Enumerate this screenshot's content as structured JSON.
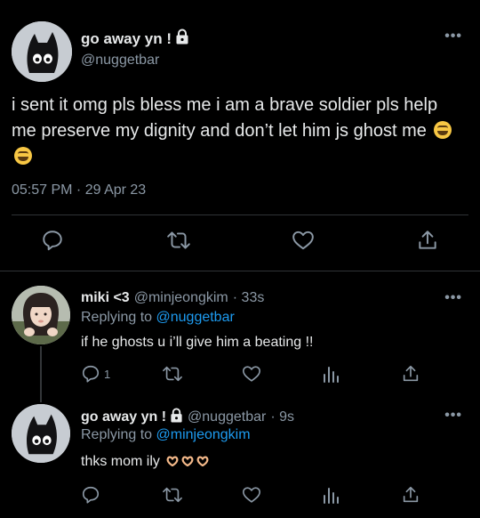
{
  "main_tweet": {
    "author_name": "go away yn !",
    "author_handle": "@nuggetbar",
    "text": "i sent it omg pls bless me i am a brave soldier pls help me preserve my dignity and don’t let him js ghost me",
    "emojis": [
      "grinning-squinting-face",
      "grinning-squinting-face"
    ],
    "timestamp": "05:57 PM · 29 Apr 23",
    "protected": true,
    "actions": [
      "reply",
      "retweet",
      "like",
      "share"
    ]
  },
  "replies": [
    {
      "author_name": "miki <3",
      "author_handle": "@minjeongkim",
      "time": "· 33s",
      "replying_to_prefix": "Replying to ",
      "replying_to": "@nuggetbar",
      "text": "if he ghosts u i’ll give him a beating !!",
      "reply_count": "1",
      "actions": [
        "reply",
        "retweet",
        "like",
        "analytics",
        "share"
      ]
    },
    {
      "author_name": "go away yn !",
      "author_handle": "@nuggetbar",
      "time": "· 9s",
      "protected": true,
      "replying_to_prefix": "Replying to ",
      "replying_to": "@minjeongkim",
      "text": "thks mom ily",
      "emojis": [
        "heart-hands",
        "heart-hands",
        "heart-hands"
      ],
      "actions": [
        "reply",
        "retweet",
        "like",
        "analytics",
        "share"
      ]
    }
  ],
  "more_label": "•••",
  "colors": {
    "background": "#000000",
    "text": "#e7e9ea",
    "secondary": "#8b98a5",
    "link": "#1d9bf0",
    "divider": "#2f3336"
  }
}
